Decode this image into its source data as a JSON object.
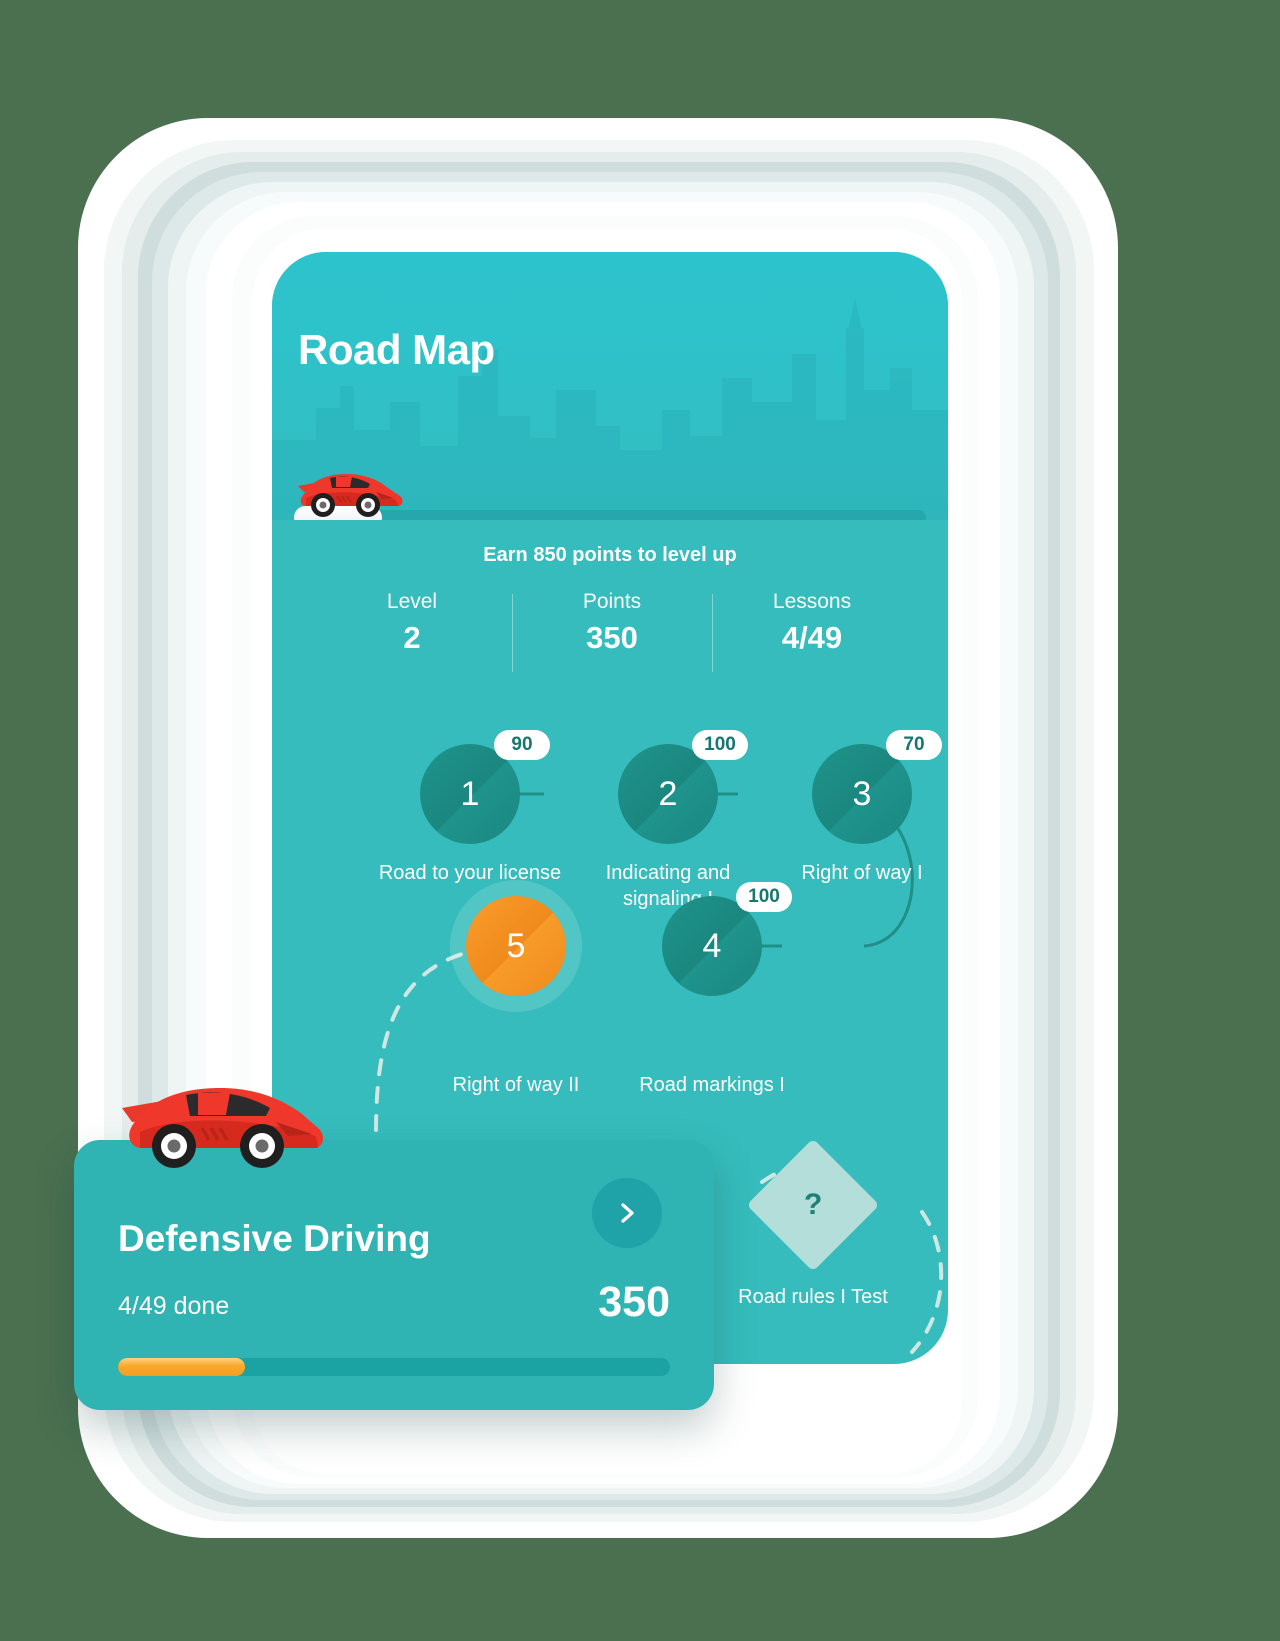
{
  "theme": {
    "page_background": "#4a7050",
    "header_teal": "#2dc3cd",
    "body_teal": "#36bcbc",
    "node_teal": "#1e948c",
    "current_node_orange": "#f7971e",
    "card_teal": "#2fb3b3",
    "diamond_mint": "#b3ded9",
    "progress_amber": "#f9a92b"
  },
  "header": {
    "title": "Road Map",
    "car_icon": "red-sports-car-icon",
    "level_caption": "Earn 850 points to level up",
    "progress_percent": 14
  },
  "stats": [
    {
      "label": "Level",
      "value": "2",
      "name": "level"
    },
    {
      "label": "Points",
      "value": "350",
      "name": "points"
    },
    {
      "label": "Lessons",
      "value": "4/49",
      "name": "lessons"
    }
  ],
  "roadmap": {
    "nodes": [
      {
        "number": "1",
        "label": "Road to your license",
        "badge": "90",
        "state": "completed"
      },
      {
        "number": "2",
        "label": "Indicating and signaling I",
        "badge": "100",
        "state": "completed"
      },
      {
        "number": "3",
        "label": "Right of way I",
        "badge": "70",
        "state": "completed"
      },
      {
        "number": "4",
        "label": "Road markings I",
        "badge": "100",
        "state": "completed"
      },
      {
        "number": "5",
        "label": "Right of way II",
        "badge": "",
        "state": "current"
      }
    ],
    "test_node": {
      "glyph": "?",
      "label": "Road rules I Test",
      "state": "locked"
    }
  },
  "course_card": {
    "title": "Defensive Driving",
    "progress_text": "4/49 done",
    "points": "350",
    "progress_percent": 23,
    "next_icon": "chevron-right-icon",
    "car_icon": "red-sports-car-icon"
  }
}
